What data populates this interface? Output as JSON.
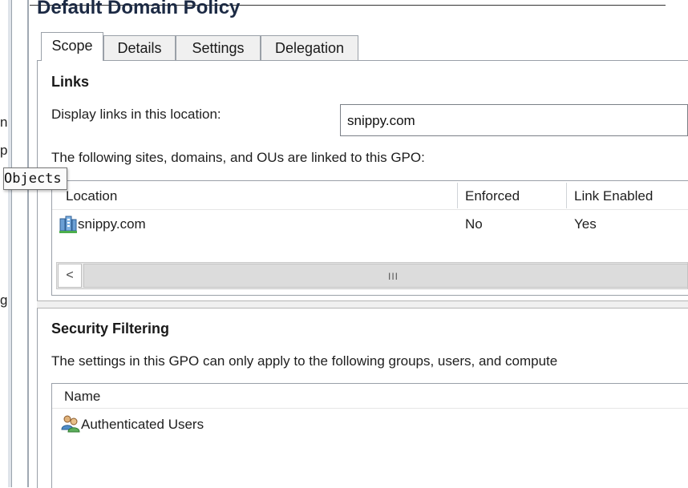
{
  "left_panel": {
    "fragments": [
      "n",
      "p",
      "g"
    ],
    "tooltip": "Objects"
  },
  "title": "Default Domain Policy",
  "tabs": [
    {
      "label": "Scope",
      "active": true
    },
    {
      "label": "Details",
      "active": false
    },
    {
      "label": "Settings",
      "active": false
    },
    {
      "label": "Delegation",
      "active": false
    }
  ],
  "links": {
    "heading": "Links",
    "display_label": "Display links in this location:",
    "display_value": "snippy.com",
    "description": "The following sites, domains, and OUs are linked to this GPO:",
    "columns": [
      "Location",
      "Enforced",
      "Link Enabled"
    ],
    "rows": [
      {
        "icon": "domain-icon",
        "location": "snippy.com",
        "enforced": "No",
        "link_enabled": "Yes"
      }
    ],
    "scroll_left_glyph": "<",
    "scroll_grip": "III"
  },
  "security_filtering": {
    "heading": "Security Filtering",
    "description": "The settings in this GPO can only apply to the following groups, users, and compute",
    "columns": [
      "Name"
    ],
    "rows": [
      {
        "icon": "users-group-icon",
        "name": "Authenticated Users"
      }
    ]
  },
  "colors": {
    "title": "#1c2a44",
    "border": "#9aa0a8",
    "tooltip_bg": "#fbfbfb"
  }
}
